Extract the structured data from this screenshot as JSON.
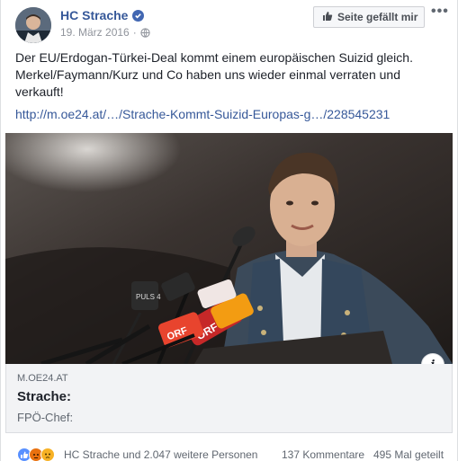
{
  "post": {
    "author": "HC Strache",
    "date": "19. März 2016",
    "like_page_label": "Seite gefällt mir",
    "more_label": "•••",
    "text": "Der EU/Erdogan-Türkei-Deal kommt einem europäischen Suizid gleich. Merkel/Faymann/Kurz und Co haben uns wieder einmal verraten und verkauft!",
    "link": "http://m.oe24.at/…/Strache-Kommt-Suizid-Europas-g…/228545231"
  },
  "link_card": {
    "domain": "M.OE24.AT",
    "title": "Strache:",
    "description": "FPÖ-Chef:",
    "info_label": "i",
    "image_labels": {
      "orf": "ORF",
      "orf2": "ORF",
      "puls4": "PULS 4"
    }
  },
  "footer": {
    "reactions_text": "HC Strache und 2.047 weitere Personen",
    "comments": "137 Kommentare",
    "shares": "495 Mal geteilt"
  },
  "colors": {
    "link": "#365899",
    "verified": "#4267b2",
    "like": "#5890ff",
    "angry": "#e9710f",
    "sad": "#f7b125"
  },
  "icons": [
    "verified-icon",
    "globe-icon",
    "thumbs-up-icon",
    "more-icon",
    "info-icon",
    "like-reaction-icon",
    "angry-reaction-icon",
    "sad-reaction-icon"
  ]
}
